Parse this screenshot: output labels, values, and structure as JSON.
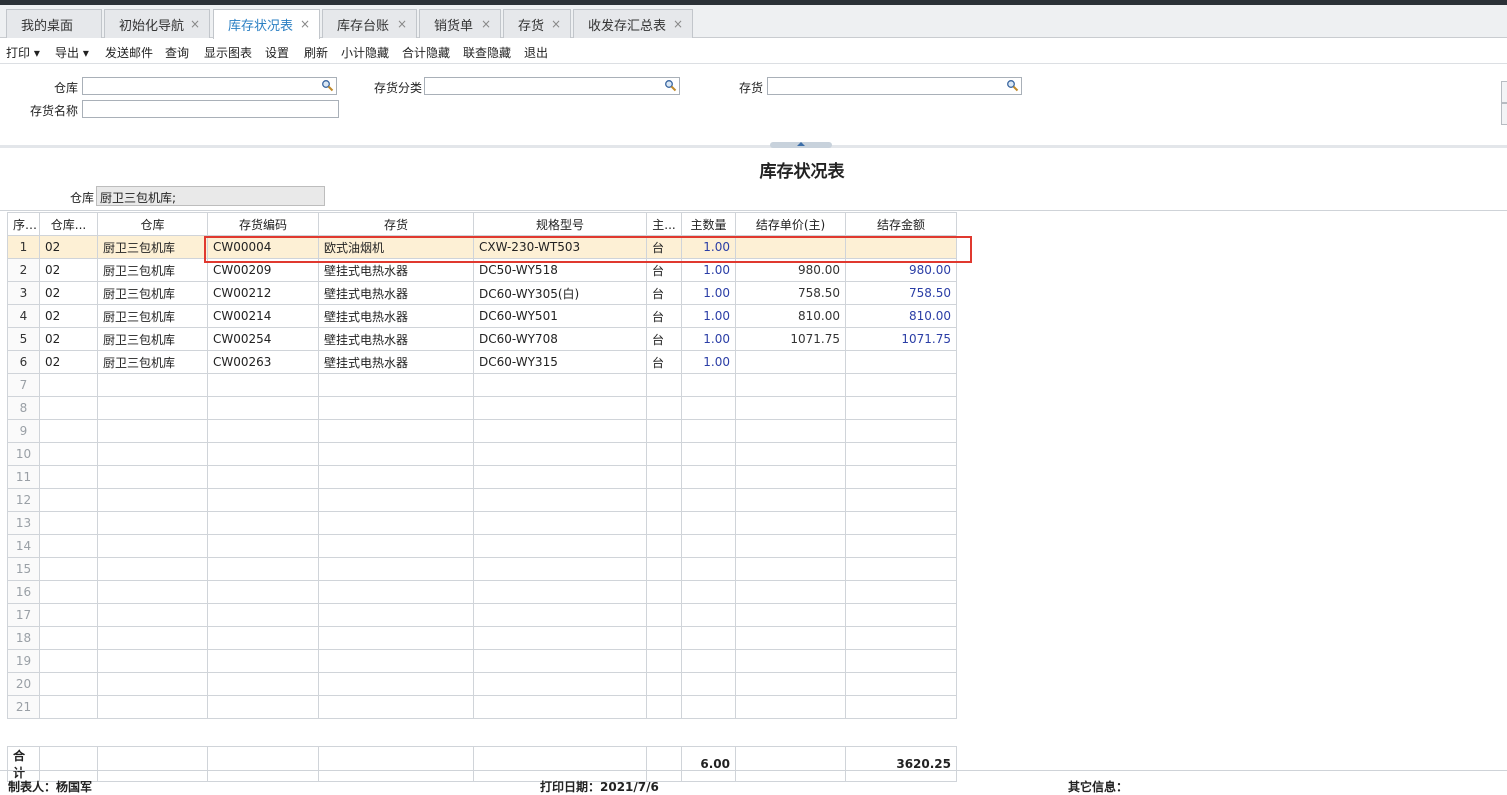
{
  "tabs": [
    {
      "label": "我的桌面",
      "closable": false
    },
    {
      "label": "初始化导航",
      "closable": true
    },
    {
      "label": "库存状况表",
      "closable": true,
      "active": true
    },
    {
      "label": "库存台账",
      "closable": true
    },
    {
      "label": "销货单",
      "closable": true
    },
    {
      "label": "存货",
      "closable": true
    },
    {
      "label": "收发存汇总表",
      "closable": true
    }
  ],
  "close_glyph": "×",
  "toolbar": {
    "print": "打印 ▾",
    "export": "导出 ▾",
    "send_mail": "发送邮件",
    "query": "查询",
    "show_chart": "显示图表",
    "settings": "设置",
    "refresh": "刷新",
    "hide_subtotal": "小计隐藏",
    "hide_total": "合计隐藏",
    "hide_link": "联查隐藏",
    "exit": "退出"
  },
  "filters": {
    "warehouse_label": "仓库",
    "category_label": "存货分类",
    "item_label": "存货",
    "item_name_label": "存货名称",
    "warehouse_value": "",
    "category_value": "",
    "item_value": "",
    "item_name_value": ""
  },
  "report": {
    "title": "库存状况表",
    "warehouse_label": "仓库",
    "warehouse_value": "厨卫三包机库;"
  },
  "grid": {
    "columns": [
      "序号",
      "仓库...",
      "仓库",
      "存货编码",
      "存货",
      "规格型号",
      "主...",
      "主数量",
      "结存单价(主)",
      "结存金额"
    ],
    "rows": [
      {
        "seq": "1",
        "wh_code": "02",
        "wh": "厨卫三包机库",
        "code": "CW00004",
        "item": "欧式油烟机",
        "spec": "CXW-230-WT503",
        "unit": "台",
        "qty": "1.00",
        "price": "",
        "amount": ""
      },
      {
        "seq": "2",
        "wh_code": "02",
        "wh": "厨卫三包机库",
        "code": "CW00209",
        "item": "壁挂式电热水器",
        "spec": "DC50-WY518",
        "unit": "台",
        "qty": "1.00",
        "price": "980.00",
        "amount": "980.00"
      },
      {
        "seq": "3",
        "wh_code": "02",
        "wh": "厨卫三包机库",
        "code": "CW00212",
        "item": "壁挂式电热水器",
        "spec": "DC60-WY305(白)",
        "unit": "台",
        "qty": "1.00",
        "price": "758.50",
        "amount": "758.50"
      },
      {
        "seq": "4",
        "wh_code": "02",
        "wh": "厨卫三包机库",
        "code": "CW00214",
        "item": "壁挂式电热水器",
        "spec": "DC60-WY501",
        "unit": "台",
        "qty": "1.00",
        "price": "810.00",
        "amount": "810.00"
      },
      {
        "seq": "5",
        "wh_code": "02",
        "wh": "厨卫三包机库",
        "code": "CW00254",
        "item": "壁挂式电热水器",
        "spec": "DC60-WY708",
        "unit": "台",
        "qty": "1.00",
        "price": "1071.75",
        "amount": "1071.75"
      },
      {
        "seq": "6",
        "wh_code": "02",
        "wh": "厨卫三包机库",
        "code": "CW00263",
        "item": "壁挂式电热水器",
        "spec": "DC60-WY315",
        "unit": "台",
        "qty": "1.00",
        "price": "",
        "amount": ""
      }
    ],
    "empty_rows": [
      "7",
      "8",
      "9",
      "10",
      "11",
      "12",
      "13",
      "14",
      "15",
      "16",
      "17",
      "18",
      "19",
      "20",
      "21"
    ],
    "total_label": "合计",
    "total_qty": "6.00",
    "total_amount": "3620.25"
  },
  "footer": {
    "maker": "制表人：杨国军",
    "print_date": "打印日期：2021/7/6",
    "other_info": "其它信息："
  }
}
